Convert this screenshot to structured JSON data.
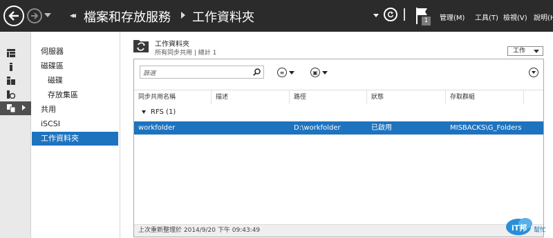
{
  "titlebar": {
    "breadcrumb_root": "檔案和存放服務",
    "breadcrumb_current": "工作資料夾",
    "notification_count": "1",
    "menu": [
      "管理(M)",
      "工具(T)",
      "檢視(V)",
      "說明(H)"
    ]
  },
  "nav": {
    "items": [
      {
        "label": "伺服器"
      },
      {
        "label": "磁碟區"
      },
      {
        "label": "磁碟"
      },
      {
        "label": "存放集區"
      },
      {
        "label": "共用"
      },
      {
        "label": "iSCSI"
      },
      {
        "label": "工作資料夾"
      }
    ]
  },
  "header": {
    "title": "工作資料夾",
    "subtitle": "所有同步共用 | 總計 1",
    "tasks_label": "工作"
  },
  "grid": {
    "filter_placeholder": "篩選",
    "columns": [
      "同步共用名稱",
      "描述",
      "路徑",
      "狀態",
      "存取群組"
    ],
    "group_label": "RFS (1)",
    "rows": [
      {
        "name": "workfolder",
        "description": "",
        "path": "D:\\workfolder",
        "status": "已啟用",
        "access_group": "MISBACKS\\G_Folders"
      }
    ],
    "status_text": "上次重新整理於 2014/9/20 下午 09:43:49"
  },
  "watermark": {
    "text": "iT邦幫忙"
  },
  "colors": {
    "titlebar_bg": "#2b2b2b",
    "selection": "#1e73be",
    "rail_bg": "#e9e9e9"
  }
}
